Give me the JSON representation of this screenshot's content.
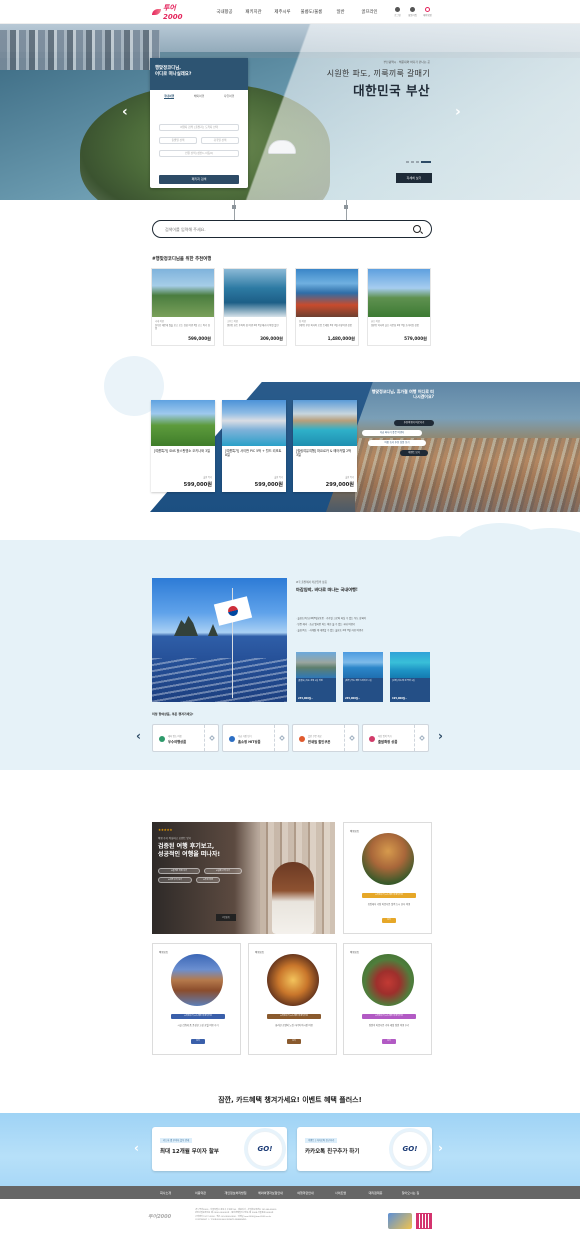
{
  "header": {
    "logo_text": "투어2000",
    "nav": [
      "국내항공",
      "패키지관",
      "제주시루",
      "울릉도/울롱",
      "일반",
      "골프라인"
    ],
    "utility": [
      "로그인",
      "회원가입",
      "예약확인"
    ]
  },
  "hero": {
    "card_title_1": "행맞정코디님,",
    "card_title_2": "어디로 떠나실래요?",
    "tabs": [
      "국내여행",
      "해외여행",
      "자유여행"
    ],
    "fields": [
      "여행지 검색 | 출발지 | 도착지 선택",
      "출발일 선택",
      "귀국일 선택",
      "인원 선택 (성인1, 아동0)"
    ],
    "search_button": "패키지 검색",
    "kicker": "부산광역시 · 해운대와 바다가 만나는 곳",
    "headline_1": "시원한 파도, 끼룩끼룩 갈매기",
    "headline_2": "대한민국 부산",
    "more_button": "자세히 보기",
    "prev": "‹",
    "next": "›"
  },
  "search": {
    "placeholder": "검색어를 입력해 주세요."
  },
  "recommend": {
    "title": "#행맞정코디님을 위한 추천여행",
    "items": [
      {
        "cat": "국내 여행",
        "desc": "[부산] 해운대 일출 보고 오는 감성 여행 3일 코스 특가 상품",
        "price": "599,000원"
      },
      {
        "cat": "크루즈 여행",
        "desc": "[통영] 요트 투어와 섬 여행 2박 3일 패키지 특별 할인",
        "price": "309,000원"
      },
      {
        "cat": "섬 여행",
        "desc": "[제주] 푸른 바다와 오름 트레킹 3박 4일 자유여행 상품",
        "price": "1,480,000원"
      },
      {
        "cat": "골프 여행",
        "desc": "[경주] 역사와 골프 라운딩 2박 3일 프리미엄 상품",
        "price": "579,000원"
      }
    ]
  },
  "band": {
    "question": "행맞정코디님, 휴가철 여행 어디로 떠나시겠어요?",
    "pills": [
      "추천여행지 바로가기",
      "지금 떠나기 좋은 여행지",
      "여름 휴가 추천 상품 보기",
      "이벤트 보기"
    ],
    "items": [
      {
        "title": "[여름특가] SNS 핫스팟명소 오키나와 3일",
        "from": "출발 특가",
        "price": "599,000원"
      },
      {
        "title": "[여름특가] 사이판 PIC 5박 + 월드 리조트 8일",
        "from": "출발 특가",
        "price": "599,000원"
      },
      {
        "title": "[힐링여유여행] 마요르카 & 에어카텔 2박 3일",
        "from": "출발 특가",
        "price": "299,000원"
      }
    ]
  },
  "dokdo": {
    "small": "#국 출발해서 마감임박 상품",
    "title": "마감임박, 바다로 떠나는 국내여행!",
    "lines": [
      "· 울릉도/독도(4박5일)/포항 · 기가릴 크로버 마실 수 있는 독도 상륙여",
      "· 인증 해녀 · 조금 엘리먼 아는 바른 물 수 있는 국내 여행기",
      "· 울릉/독도 · 사계절 제 대행할 수 있는 울릉도 2박 3일 자유 여행기"
    ],
    "cards": [
      {
        "t": "[울릉도] 독도 상륙 3일 여행",
        "p": "245,000원~"
      },
      {
        "t": "[제주] 우도 해안 드라이브 2일",
        "p": "265,000원~"
      },
      {
        "t": "[남해] 다도해 섬 투어 3일",
        "p": "195,000원~"
      }
    ]
  },
  "tickets": {
    "title": "미정 항여상품, 쿠폰 챙겨가세요!",
    "items": [
      {
        "sub": "테마 명소 여행",
        "name": "우수여행상품"
      },
      {
        "sub": "지금 가장 인기",
        "name": "홈쇼핑 HIT상품"
      },
      {
        "sub": "할인 쿠폰 제공",
        "name": "반새밀 할인쿠폰"
      },
      {
        "sub": "마감 임박 특가",
        "name": "출발확정 상품"
      }
    ]
  },
  "review": {
    "stars": "★★★★★",
    "small": "여행 후기 작성하고 포인트 받기",
    "headline_1": "검증된 여행 후기보고,",
    "headline_2": "성공적인 여행을 떠나자!",
    "tags": [
      "#솔직한 여행 후기",
      "#실제 고객 후기",
      "#사진 후기 보기",
      "#추천 여행"
    ],
    "button": "더 보기"
  },
  "spots": [
    {
      "label": "여행포토",
      "badge": "#여행후기 #스페인 여행지추천",
      "desc": "유럽에서 가장 아름다운 절벽 도시 론다 여행",
      "button": "보기"
    },
    {
      "label": "여행포토",
      "badge": "#여행후기 #스페인 여행지추천",
      "desc": "시골 진흙에 품 풍성한 고성 호텔 여행 후기",
      "button": "보기"
    },
    {
      "label": "여행포토",
      "badge": "#여행후기 #스페인 여행지추천",
      "desc": "화려한 조명의 노점 거리와 야시장 여행",
      "button": "보기"
    },
    {
      "label": "여행포토",
      "badge": "#여행후기 #스페인 여행지추천",
      "desc": "정원이 아름다운 기차 레일 정원 여행 후기",
      "button": "보기"
    }
  ],
  "event": {
    "title": "잠깐, 카드혜택 챙겨가세요! 이벤트 혜택 플러스!",
    "cards": [
      {
        "tag": "카드사 별 무이자 할부 안내",
        "title": "최대 12개월 무이자 할부",
        "go": "GO!"
      },
      {
        "tag": "이벤트 | 카카오톡 친구추가",
        "title": "카카오톡 친구추가 하기",
        "go": "GO!"
      }
    ]
  },
  "footer": {
    "nav": [
      "회사소개",
      "이용약관",
      "개인정보처리방침",
      "해외여행자보험안내",
      "여행약관안내",
      "사이트맵",
      "대리점제휴",
      "찾아오시는 길"
    ],
    "logo": "투어2000",
    "info": [
      "(주) 투어2000 · 서울특별시 종로구 수표로 96 · 대표이사 · 사업자등록번호 101-86-00000",
      "관광사업등록번호 제 2000-000003호 · 통신판매업신고번호 제 2008-서울종로-0000호",
      "고객센터 1577-2000 · 팩스 02-0000-0000 · 이메일 tour2000@tour2000.co.kr",
      "COPYRIGHT © TOUR2000 ALL RIGHTS RESERVED."
    ]
  }
}
